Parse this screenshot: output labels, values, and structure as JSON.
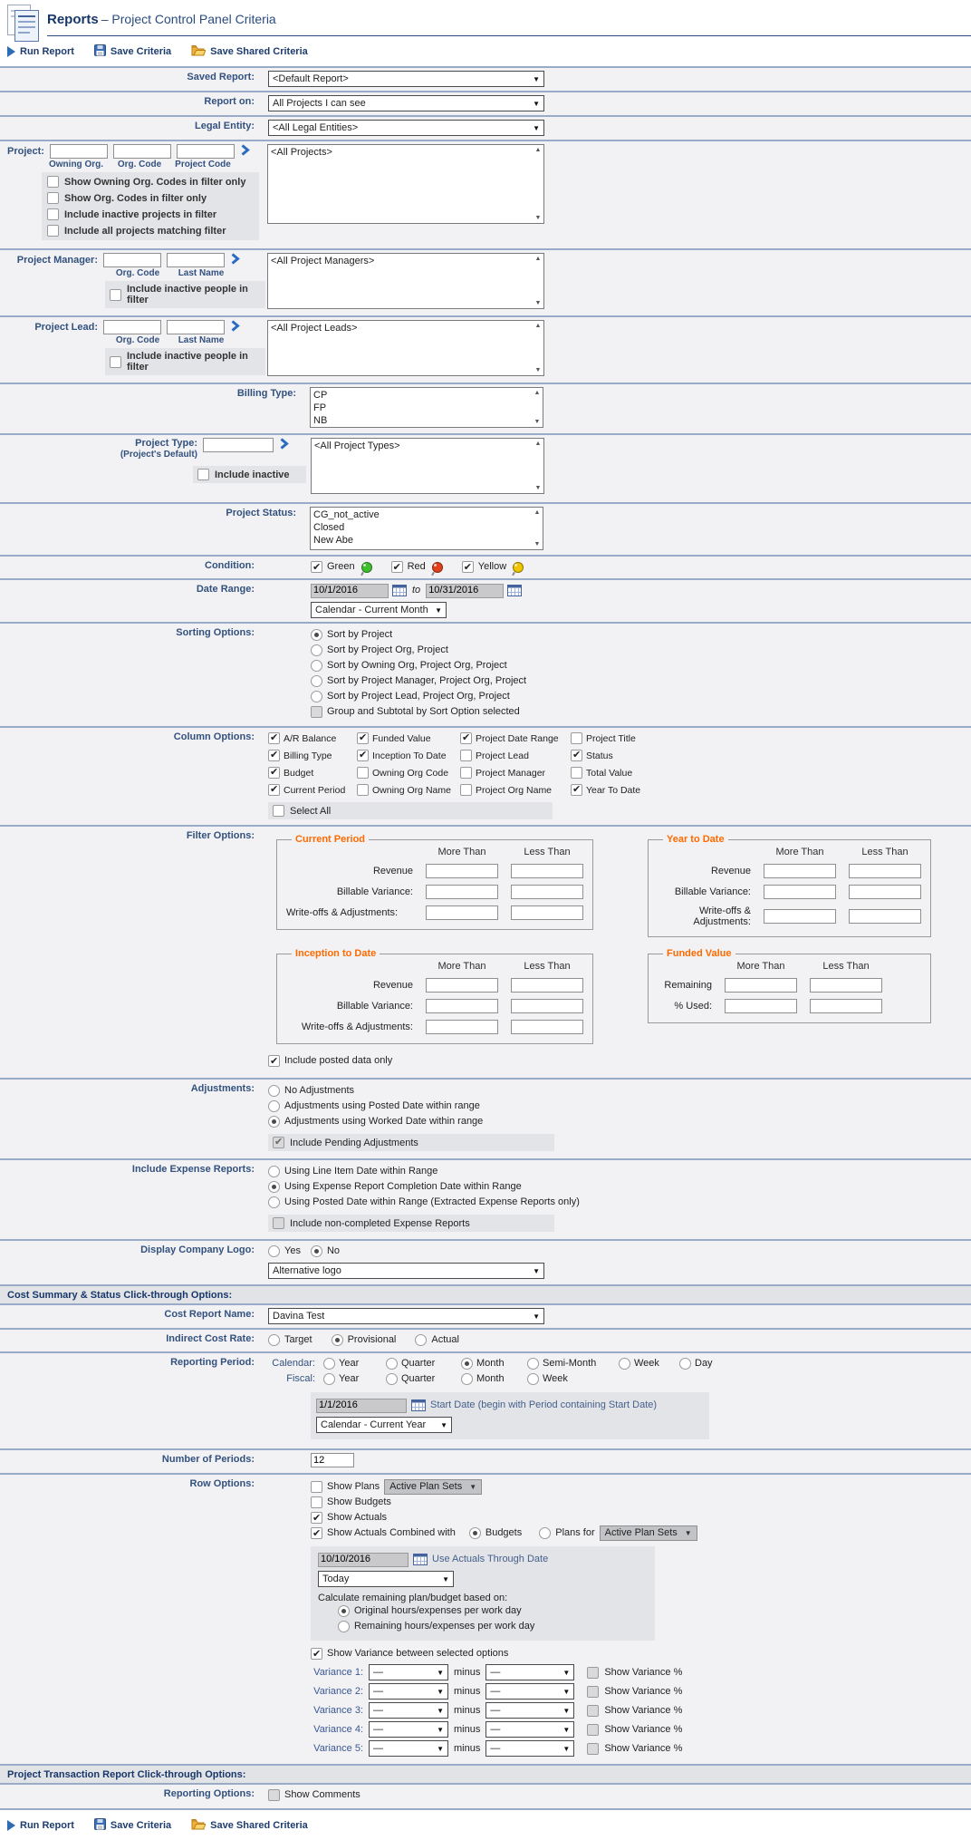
{
  "header": {
    "title": "Reports",
    "subtitle": "– Project Control Panel Criteria"
  },
  "toolbar": {
    "run": "Run Report",
    "save": "Save Criteria",
    "share": "Save Shared Criteria"
  },
  "saved_report": {
    "label": "Saved Report:",
    "value": "<Default Report>"
  },
  "report_on": {
    "label": "Report on:",
    "value": "All Projects I can see"
  },
  "legal_entity": {
    "label": "Legal Entity:",
    "value": "<All Legal Entities>"
  },
  "project": {
    "label": "Project:",
    "cols": [
      "Owning Org.",
      "Org. Code",
      "Project Code"
    ],
    "checkboxes": [
      {
        "label": "Show Owning Org. Codes in filter only",
        "checked": false
      },
      {
        "label": "Show Org. Codes in filter only",
        "checked": false
      },
      {
        "label": "Include inactive projects in filter",
        "checked": false
      },
      {
        "label": "Include all projects matching filter",
        "checked": false
      }
    ],
    "list_value": "<All Projects>"
  },
  "project_manager": {
    "label": "Project Manager:",
    "cols": [
      "Org. Code",
      "Last Name"
    ],
    "checkbox": {
      "label": "Include inactive people in filter",
      "checked": false
    },
    "list_value": "<All Project Managers>"
  },
  "project_lead": {
    "label": "Project Lead:",
    "cols": [
      "Org. Code",
      "Last Name"
    ],
    "checkbox": {
      "label": "Include inactive people in filter",
      "checked": false
    },
    "list_value": "<All Project Leads>"
  },
  "billing_type": {
    "label": "Billing Type:",
    "options": [
      "CP",
      "FP",
      "NB"
    ]
  },
  "project_type": {
    "label": "Project Type:",
    "sublabel": "(Project's Default)",
    "checkbox": {
      "label": "Include inactive",
      "checked": false
    },
    "list_value": "<All Project Types>"
  },
  "project_status": {
    "label": "Project Status:",
    "options": [
      "CG_not_active",
      "Closed",
      "New Abe"
    ]
  },
  "condition": {
    "label": "Condition:",
    "items": [
      {
        "label": "Green",
        "checked": true,
        "color": "#3FBF2F"
      },
      {
        "label": "Red",
        "checked": true,
        "color": "#E0401A"
      },
      {
        "label": "Yellow",
        "checked": true,
        "color": "#EFC400"
      }
    ]
  },
  "date_range": {
    "label": "Date Range:",
    "from": "10/1/2016",
    "to_word": "to",
    "to": "10/31/2016",
    "preset": "Calendar - Current Month"
  },
  "sorting": {
    "label": "Sorting Options:",
    "options": [
      {
        "label": "Sort by Project",
        "selected": true
      },
      {
        "label": "Sort by Project Org, Project",
        "selected": false
      },
      {
        "label": "Sort by Owning Org, Project Org, Project",
        "selected": false
      },
      {
        "label": "Sort by Project Manager, Project Org, Project",
        "selected": false
      },
      {
        "label": "Sort by Project Lead, Project Org, Project",
        "selected": false
      }
    ],
    "group": {
      "label": "Group and Subtotal by Sort Option selected",
      "checked": false
    }
  },
  "column_options": {
    "label": "Column Options:",
    "items": [
      {
        "label": "A/R Balance",
        "checked": true
      },
      {
        "label": "Funded Value",
        "checked": true
      },
      {
        "label": "Project Date Range",
        "checked": true
      },
      {
        "label": "Project Title",
        "checked": false
      },
      {
        "label": "Billing Type",
        "checked": true
      },
      {
        "label": "Inception To Date",
        "checked": true
      },
      {
        "label": "Project Lead",
        "checked": false
      },
      {
        "label": "Status",
        "checked": true
      },
      {
        "label": "Budget",
        "checked": true
      },
      {
        "label": "Owning Org Code",
        "checked": false
      },
      {
        "label": "Project Manager",
        "checked": false
      },
      {
        "label": "Total Value",
        "checked": false
      },
      {
        "label": "Current Period",
        "checked": true
      },
      {
        "label": "Owning Org Name",
        "checked": false
      },
      {
        "label": "Project Org Name",
        "checked": false
      },
      {
        "label": "Year To Date",
        "checked": true
      }
    ],
    "select_all": {
      "label": "Select All",
      "checked": false
    }
  },
  "filter_options": {
    "label": "Filter Options:",
    "more": "More Than",
    "less": "Less Than",
    "current_period": {
      "title": "Current Period",
      "rows": [
        "Revenue",
        "Billable Variance:",
        "Write-offs & Adjustments:"
      ]
    },
    "year_to_date": {
      "title": "Year to Date",
      "rows": [
        "Revenue",
        "Billable Variance:",
        "Write-offs & Adjustments:"
      ]
    },
    "inception_to_date": {
      "title": "Inception to Date",
      "rows": [
        "Revenue",
        "Billable Variance:",
        "Write-offs & Adjustments:"
      ]
    },
    "funded_value": {
      "title": "Funded Value",
      "rows": [
        "Remaining",
        "% Used:"
      ]
    },
    "include_posted": {
      "label": "Include posted data only",
      "checked": true
    }
  },
  "adjustments": {
    "label": "Adjustments:",
    "options": [
      {
        "label": "No Adjustments",
        "selected": false
      },
      {
        "label": "Adjustments using Posted Date within range",
        "selected": false
      },
      {
        "label": "Adjustments using Worked Date within range",
        "selected": true
      }
    ],
    "pending": {
      "label": "Include Pending Adjustments",
      "checked": true
    }
  },
  "expense_reports": {
    "label": "Include Expense Reports:",
    "options": [
      {
        "label": "Using Line Item Date within Range",
        "selected": false
      },
      {
        "label": "Using Expense Report Completion Date within Range",
        "selected": true
      },
      {
        "label": "Using Posted Date within Range (Extracted Expense Reports only)",
        "selected": false
      }
    ],
    "non_completed": {
      "label": "Include non-completed Expense Reports",
      "checked": false
    }
  },
  "company_logo": {
    "label": "Display Company Logo:",
    "options": [
      {
        "label": "Yes",
        "selected": false
      },
      {
        "label": "No",
        "selected": true
      }
    ],
    "dropdown": "Alternative logo"
  },
  "cost_section": {
    "title": "Cost Summary & Status Click-through Options:"
  },
  "cost_report_name": {
    "label": "Cost Report Name:",
    "value": "Davina Test"
  },
  "indirect_cost_rate": {
    "label": "Indirect Cost Rate:",
    "options": [
      {
        "label": "Target",
        "selected": false
      },
      {
        "label": "Provisional",
        "selected": true
      },
      {
        "label": "Actual",
        "selected": false
      }
    ]
  },
  "reporting_period": {
    "label": "Reporting Period:",
    "calendar_label": "Calendar:",
    "calendar_options": [
      {
        "label": "Year",
        "selected": false
      },
      {
        "label": "Quarter",
        "selected": false
      },
      {
        "label": "Month",
        "selected": true
      },
      {
        "label": "Semi-Month",
        "selected": false
      },
      {
        "label": "Week",
        "selected": false
      },
      {
        "label": "Day",
        "selected": false
      }
    ],
    "fiscal_label": "Fiscal:",
    "fiscal_options": [
      {
        "label": "Year",
        "selected": false
      },
      {
        "label": "Quarter",
        "selected": false
      },
      {
        "label": "Month",
        "selected": false
      },
      {
        "label": "Week",
        "selected": false
      }
    ],
    "start_date": "1/1/2016",
    "start_date_label": "Start Date (begin with Period containing Start Date)",
    "preset": "Calendar - Current Year"
  },
  "number_of_periods": {
    "label": "Number of Periods:",
    "value": "12"
  },
  "row_options": {
    "label": "Row Options:",
    "show_plans": {
      "label": "Show Plans",
      "checked": false
    },
    "show_plans_dropdown": "Active Plan Sets",
    "show_budgets": {
      "label": "Show Budgets",
      "checked": false
    },
    "show_actuals": {
      "label": "Show Actuals",
      "checked": true
    },
    "combined": {
      "label": "Show Actuals Combined with",
      "checked": true
    },
    "combined_options": [
      {
        "label": "Budgets",
        "selected": true
      },
      {
        "label": "Plans for",
        "selected": false
      }
    ],
    "plans_dropdown": "Active Plan Sets",
    "actuals_date": "10/10/2016",
    "actuals_date_label": "Use Actuals Through Date",
    "actuals_preset": "Today",
    "calc_label": "Calculate remaining plan/budget based on:",
    "calc_options": [
      {
        "label": "Original hours/expenses per work day",
        "selected": true
      },
      {
        "label": "Remaining hours/expenses per work day",
        "selected": false
      }
    ],
    "variance_toggle": {
      "label": "Show Variance between selected options",
      "checked": true
    },
    "variance_placeholder": "—",
    "minus": "minus",
    "show_pct": "Show Variance %",
    "variance_rows": [
      {
        "label": "Variance 1:",
        "pct_checked": false
      },
      {
        "label": "Variance 2:",
        "pct_checked": false
      },
      {
        "label": "Variance 3:",
        "pct_checked": false
      },
      {
        "label": "Variance 4:",
        "pct_checked": false
      },
      {
        "label": "Variance 5:",
        "pct_checked": false
      }
    ]
  },
  "transaction_section": {
    "title": "Project Transaction Report Click-through Options:"
  },
  "reporting_options": {
    "label": "Reporting Options:",
    "checkbox": {
      "label": "Show Comments",
      "checked": false
    }
  }
}
